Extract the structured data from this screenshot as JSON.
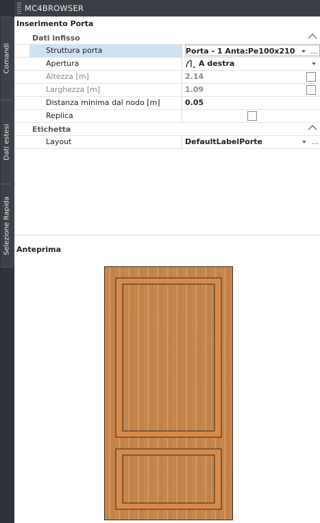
{
  "window": {
    "title": "MC4BROWSER"
  },
  "side_tabs": [
    "Comandi",
    "Dati estesi",
    "Selezione Rapida"
  ],
  "panel": {
    "section_title": "Inserimento Porta"
  },
  "categories": [
    {
      "name": "Dati infisso",
      "rows": [
        {
          "name": "Struttura porta",
          "value": "Porta - 1 Anta:Pe100x210"
        },
        {
          "name": "Apertura",
          "value": "A destra"
        },
        {
          "name": "Altezza [m]",
          "value": "2.14"
        },
        {
          "name": "Larghezza [m]",
          "value": "1.09"
        },
        {
          "name": "Distanza minima dal nodo [m]",
          "value": "0.05"
        },
        {
          "name": "Replica",
          "value": ""
        }
      ]
    },
    {
      "name": "Etichetta",
      "rows": [
        {
          "name": "Layout",
          "value": "DefaultLabelPorte"
        }
      ]
    }
  ],
  "ellipsis": "...",
  "preview": {
    "title": "Anteprima"
  },
  "colors": {
    "titlebar": "#3b3f45",
    "side_tabs": "#2f3339",
    "selected_row": "#cfe2f3",
    "door_wood": "#c9894d",
    "door_frame": "#d38a4e"
  }
}
